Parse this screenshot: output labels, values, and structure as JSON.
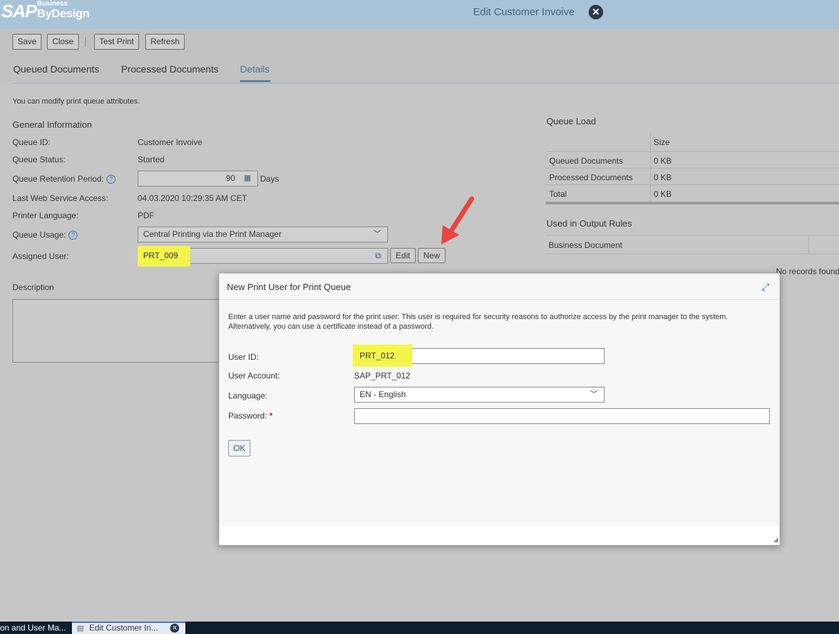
{
  "shell": {
    "logo_sap": "SAP",
    "logo_small": "Business",
    "logo_big": "ByDesign",
    "title": "Edit Customer Invoive",
    "close_icon": "close-circle-icon"
  },
  "toolbar": {
    "save": "Save",
    "close": "Close",
    "test_print": "Test Print",
    "refresh": "Refresh"
  },
  "tabs": [
    {
      "label": "Queued Documents"
    },
    {
      "label": "Processed Documents"
    },
    {
      "label": "Details"
    }
  ],
  "hint": "You can modify print queue attributes.",
  "general": {
    "title": "General Information",
    "queue_id_label": "Queue ID:",
    "queue_id": "Customer Invoive",
    "queue_status_label": "Queue Status:",
    "queue_status": "Started",
    "retention_label": "Queue Retention Period:",
    "retention_value": "90",
    "retention_unit": "Days",
    "last_access_label": "Last Web Service Access:",
    "last_access": "04.03.2020 10:29:35 AM CET",
    "printer_lang_label": "Printer Language:",
    "printer_lang": "PDF",
    "usage_label": "Queue Usage:",
    "usage_value": "Central Printing via the Print Manager",
    "assigned_user_label": "Assigned User:",
    "assigned_user": "PRT_009",
    "edit": "Edit",
    "new": "New"
  },
  "description": {
    "title": "Description"
  },
  "queue_load": {
    "title": "Queue Load",
    "header_size": "Size",
    "rows": [
      {
        "name": "Queued Documents",
        "size": "0 KB"
      },
      {
        "name": "Processed Documents",
        "size": "0 KB"
      },
      {
        "name": "Total",
        "size": "0 KB"
      }
    ]
  },
  "output_rules": {
    "title": "Used in Output Rules",
    "header": "Business Document",
    "empty": "No records found"
  },
  "dialog": {
    "title": "New Print User for Print Queue",
    "text": "Enter a user name and password for the print user. This user is required for security reasons to authorize access by the print manager to the system. Alternatively, you can use a certificate instead of a password.",
    "user_id_label": "User ID:",
    "user_id": "PRT_012",
    "account_label": "User Account:",
    "account": "SAP_PRT_012",
    "language_label": "Language:",
    "language": "EN - English",
    "password_label": "Password:",
    "required_mark": "*",
    "password": "",
    "ok": "OK"
  },
  "taskbar": {
    "item1": "on and User Ma...",
    "item2": "Edit Customer In..."
  },
  "colors": {
    "shell_bg": "#a9c3d9",
    "highlight": "#f4f54c",
    "arrow": "#e8453c",
    "accent": "#4a6e8f"
  }
}
